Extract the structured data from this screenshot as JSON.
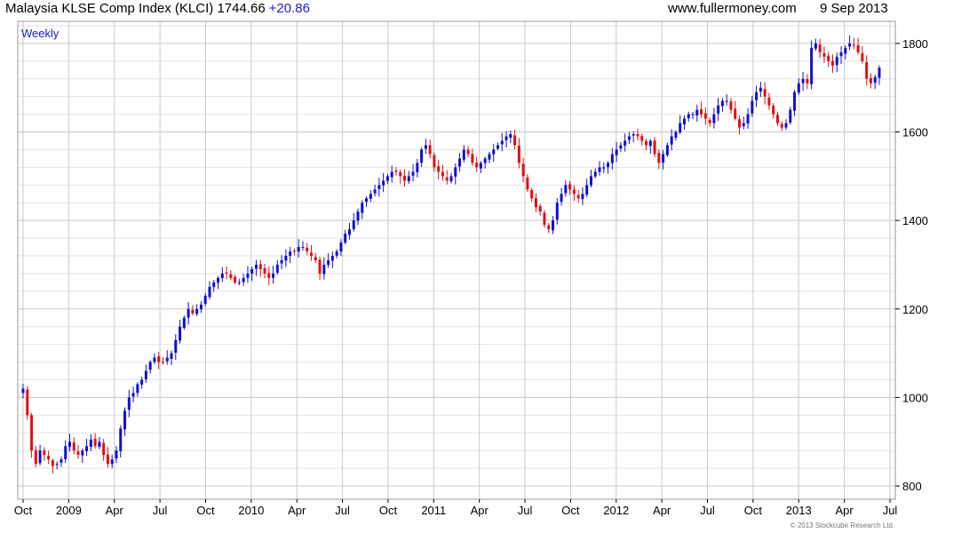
{
  "header": {
    "title": "Malaysia KLSE Comp Index (KLCI)",
    "last": "1744.66",
    "change": "+20.86",
    "site": "www.fullermoney.com",
    "date": "9 Sep 2013"
  },
  "panel_label": "Weekly",
  "copyright": "© 2013 Stockcube Research Ltd",
  "colors": {
    "up": "#1010d0",
    "down": "#e01010",
    "grid": "#e2e2e2",
    "grid_major": "#c8c8c8",
    "frame": "#9a9a9a",
    "label": "#1a1ad0"
  },
  "chart_data": {
    "type": "candlestick",
    "frequency": "weekly",
    "x_tick_labels": [
      "Oct",
      "2009",
      "Apr",
      "Jul",
      "Oct",
      "2010",
      "Apr",
      "Jul",
      "Oct",
      "2011",
      "Apr",
      "Jul",
      "Oct",
      "2012",
      "Apr",
      "Jul",
      "Oct",
      "2013",
      "Apr",
      "Jul"
    ],
    "y_ticks": [
      800,
      1000,
      1200,
      1400,
      1600,
      1800
    ],
    "ylim": [
      770,
      1850
    ],
    "scale": "linear",
    "grid": true,
    "y_axis_side": "right",
    "closes": [
      1020,
      960,
      880,
      850,
      880,
      870,
      860,
      845,
      850,
      860,
      890,
      900,
      880,
      870,
      880,
      890,
      905,
      890,
      900,
      870,
      850,
      860,
      880,
      930,
      970,
      1000,
      1010,
      1030,
      1040,
      1060,
      1080,
      1090,
      1080,
      1080,
      1090,
      1100,
      1130,
      1160,
      1180,
      1200,
      1190,
      1200,
      1210,
      1230,
      1250,
      1260,
      1270,
      1280,
      1280,
      1270,
      1260,
      1260,
      1270,
      1280,
      1290,
      1300,
      1290,
      1280,
      1270,
      1280,
      1300,
      1310,
      1320,
      1330,
      1330,
      1340,
      1340,
      1330,
      1320,
      1310,
      1280,
      1300,
      1310,
      1320,
      1330,
      1350,
      1370,
      1380,
      1400,
      1420,
      1440,
      1450,
      1460,
      1470,
      1480,
      1490,
      1500,
      1510,
      1510,
      1500,
      1490,
      1500,
      1510,
      1530,
      1560,
      1570,
      1550,
      1520,
      1510,
      1500,
      1490,
      1500,
      1520,
      1540,
      1560,
      1550,
      1530,
      1520,
      1530,
      1540,
      1550,
      1560,
      1570,
      1580,
      1590,
      1595,
      1570,
      1530,
      1500,
      1470,
      1450,
      1430,
      1420,
      1390,
      1380,
      1400,
      1440,
      1460,
      1480,
      1470,
      1460,
      1450,
      1460,
      1480,
      1500,
      1510,
      1520,
      1520,
      1530,
      1550,
      1560,
      1570,
      1580,
      1590,
      1595,
      1590,
      1580,
      1570,
      1580,
      1550,
      1530,
      1550,
      1570,
      1590,
      1600,
      1620,
      1630,
      1640,
      1640,
      1650,
      1640,
      1630,
      1620,
      1640,
      1660,
      1670,
      1670,
      1650,
      1630,
      1610,
      1620,
      1640,
      1670,
      1690,
      1700,
      1680,
      1660,
      1640,
      1620,
      1610,
      1620,
      1650,
      1690,
      1710,
      1720,
      1710,
      1790,
      1800,
      1780,
      1770,
      1760,
      1750,
      1770,
      1780,
      1790,
      1800,
      1795,
      1780,
      1760,
      1720,
      1710,
      1724,
      1745
    ],
    "lows_min": 800,
    "highs_max": 1830,
    "last_close": 1744.66,
    "last_change": 20.86
  }
}
